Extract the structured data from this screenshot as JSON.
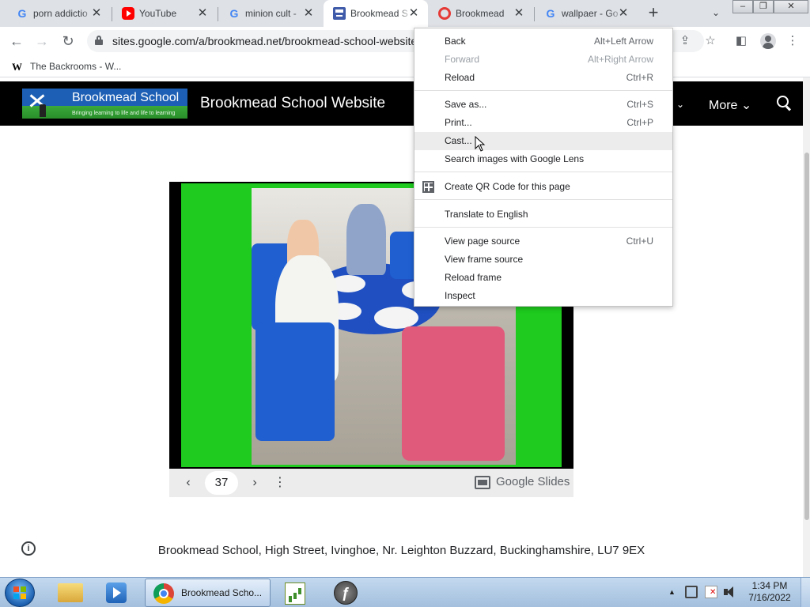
{
  "tabs": [
    {
      "title": "porn addictio",
      "favicon": "google-icon",
      "active": false
    },
    {
      "title": "YouTube",
      "favicon": "youtube-icon",
      "active": false
    },
    {
      "title": "minion cult -",
      "favicon": "google-icon",
      "active": false
    },
    {
      "title": "Brookmead S",
      "favicon": "sites-icon",
      "active": true
    },
    {
      "title": "Brookmead",
      "favicon": "red-ring-icon",
      "active": false
    },
    {
      "title": "wallpaer - Go",
      "favicon": "google-icon",
      "active": false
    }
  ],
  "toolbar": {
    "url": "sites.google.com/a/brookmead.net/brookmead-school-website"
  },
  "bookmarks": [
    {
      "label": "The Backrooms - W..."
    }
  ],
  "site": {
    "logo_name": "Brookmead School",
    "logo_tagline": "Bringing learning to life and life to learning",
    "title": "Brookmead School Website",
    "nav_more": "More",
    "header_color": "#000000"
  },
  "slides": {
    "page_number": "37",
    "brand": "Google Slides",
    "slide_bg": "#1ecb1e"
  },
  "footer": {
    "address": "Brookmead School, High Street, Ivinghoe, Nr. Leighton Buzzard, Buckinghamshire, LU7 9EX"
  },
  "context_menu": {
    "items": [
      {
        "label": "Back",
        "shortcut": "Alt+Left Arrow",
        "disabled": false
      },
      {
        "label": "Forward",
        "shortcut": "Alt+Right Arrow",
        "disabled": true
      },
      {
        "label": "Reload",
        "shortcut": "Ctrl+R",
        "disabled": false
      },
      {
        "label": "Save as...",
        "shortcut": "Ctrl+S",
        "disabled": false
      },
      {
        "label": "Print...",
        "shortcut": "Ctrl+P",
        "disabled": false
      },
      {
        "label": "Cast...",
        "shortcut": "",
        "disabled": false,
        "hovered": true
      },
      {
        "label": "Search images with Google Lens",
        "shortcut": "",
        "disabled": false
      },
      {
        "label": "Create QR Code for this page",
        "shortcut": "",
        "disabled": false,
        "icon": "qr-code-icon"
      },
      {
        "label": "Translate to English",
        "shortcut": "",
        "disabled": false
      },
      {
        "label": "View page source",
        "shortcut": "Ctrl+U",
        "disabled": false
      },
      {
        "label": "View frame source",
        "shortcut": "",
        "disabled": false
      },
      {
        "label": "Reload frame",
        "shortcut": "",
        "disabled": false
      },
      {
        "label": "Inspect",
        "shortcut": "",
        "disabled": false
      }
    ]
  },
  "taskbar": {
    "active_window": "Brookmead Scho...",
    "time": "1:34 PM",
    "date": "7/16/2022"
  }
}
